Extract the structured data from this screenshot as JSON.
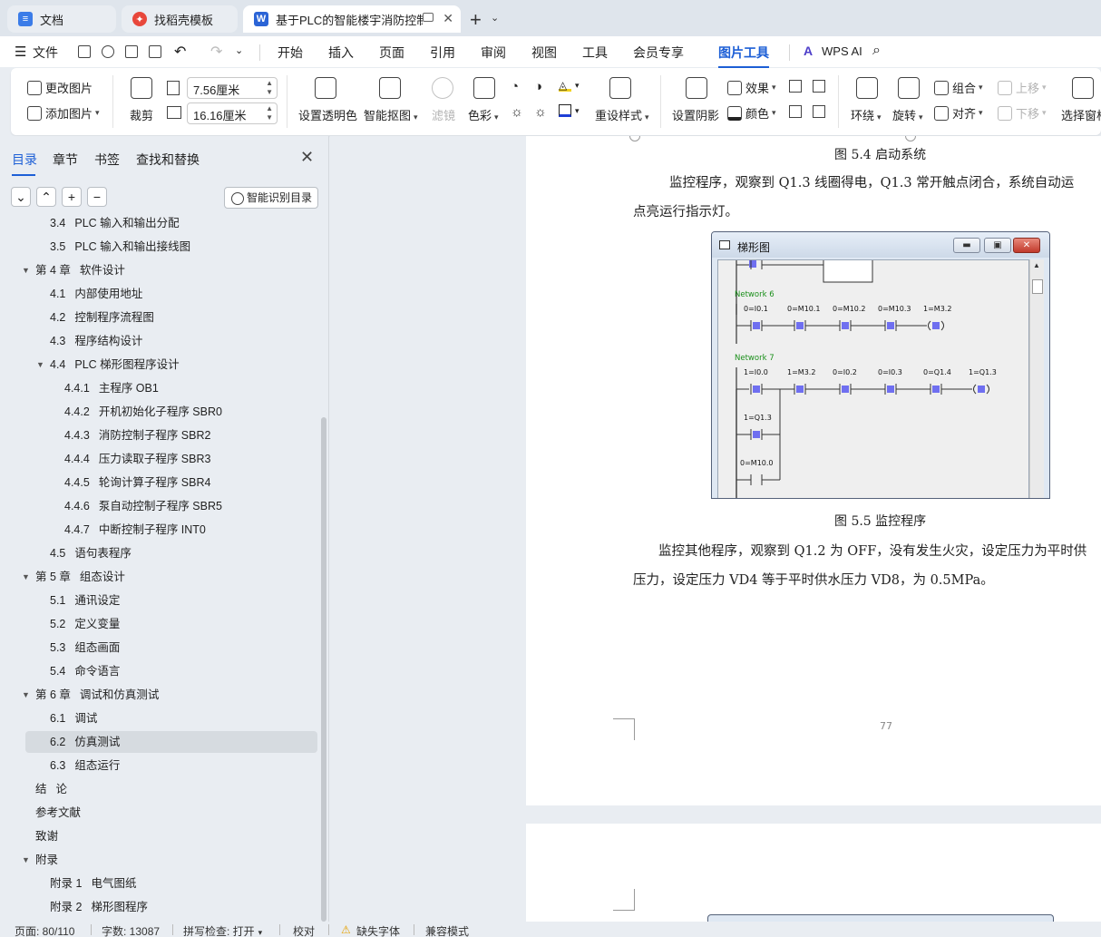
{
  "tabs": [
    {
      "label": "文档",
      "icon": "docs-icon"
    },
    {
      "label": "找稻壳模板",
      "icon": "docer-icon"
    },
    {
      "label": "基于PLC的智能楼宇消防控制系",
      "icon": "word-doc-icon"
    }
  ],
  "menu": {
    "file": "文件",
    "items": [
      "开始",
      "插入",
      "页面",
      "引用",
      "审阅",
      "视图",
      "工具",
      "会员专享",
      "图片工具"
    ],
    "active": "图片工具",
    "wps_ai": "WPS AI"
  },
  "ribbon": {
    "change_image": "更改图片",
    "add_image": "添加图片",
    "crop": "裁剪",
    "width_value": "7.56厘米",
    "height_value": "16.16厘米",
    "set_transparent": "设置透明色",
    "smart_cutout": "智能抠图",
    "filter": "滤镜",
    "color": "色彩",
    "reset_style": "重设样式",
    "set_shadow": "设置阴影",
    "effect": "效果",
    "color2": "颜色",
    "wrap": "环绕",
    "rotate": "旋转",
    "group": "组合",
    "align": "对齐",
    "move_up": "上移",
    "move_down": "下移",
    "select_pane": "选择窗格"
  },
  "panel": {
    "tabs": [
      "目录",
      "章节",
      "书签",
      "查找和替换"
    ],
    "active_tab": "目录",
    "ai_toc_button": "智能识别目录",
    "toc": [
      {
        "num": "3.4",
        "text": "PLC 输入和输出分配",
        "level": 2
      },
      {
        "num": "3.5",
        "text": "PLC 输入和输出接线图",
        "level": 2
      },
      {
        "num": "第 4 章",
        "text": "软件设计",
        "level": 1,
        "expanded": true
      },
      {
        "num": "4.1",
        "text": "内部使用地址",
        "level": 2
      },
      {
        "num": "4.2",
        "text": "控制程序流程图",
        "level": 2
      },
      {
        "num": "4.3",
        "text": "程序结构设计",
        "level": 2
      },
      {
        "num": "4.4",
        "text": "PLC 梯形图程序设计",
        "level": 2,
        "expanded": true
      },
      {
        "num": "4.4.1",
        "text": "主程序 OB1",
        "level": 3
      },
      {
        "num": "4.4.2",
        "text": "开机初始化子程序 SBR0",
        "level": 3
      },
      {
        "num": "4.4.3",
        "text": "消防控制子程序 SBR2",
        "level": 3
      },
      {
        "num": "4.4.4",
        "text": "压力读取子程序 SBR3",
        "level": 3
      },
      {
        "num": "4.4.5",
        "text": "轮询计算子程序 SBR4",
        "level": 3
      },
      {
        "num": "4.4.6",
        "text": "泵自动控制子程序 SBR5",
        "level": 3
      },
      {
        "num": "4.4.7",
        "text": "中断控制子程序 INT0",
        "level": 3
      },
      {
        "num": "4.5",
        "text": "语句表程序",
        "level": 2
      },
      {
        "num": "第 5 章",
        "text": "组态设计",
        "level": 1,
        "expanded": true
      },
      {
        "num": "5.1",
        "text": "通讯设定",
        "level": 2
      },
      {
        "num": "5.2",
        "text": "定义变量",
        "level": 2
      },
      {
        "num": "5.3",
        "text": "组态画面",
        "level": 2
      },
      {
        "num": "5.4",
        "text": "命令语言",
        "level": 2
      },
      {
        "num": "第 6 章",
        "text": "调试和仿真测试",
        "level": 1,
        "expanded": true
      },
      {
        "num": "6.1",
        "text": "调试",
        "level": 2
      },
      {
        "num": "6.2",
        "text": "仿真测试",
        "level": 2,
        "selected": true
      },
      {
        "num": "6.3",
        "text": "组态运行",
        "level": 2
      },
      {
        "num": "结",
        "text": "论",
        "level": 1
      },
      {
        "num": "",
        "text": "参考文献",
        "level": 1
      },
      {
        "num": "",
        "text": "致谢",
        "level": 1
      },
      {
        "num": "",
        "text": "附录",
        "level": 1,
        "expanded": true
      },
      {
        "num": "附录 1",
        "text": "电气图纸",
        "level": 2
      },
      {
        "num": "附录 2",
        "text": "梯形图程序",
        "level": 2
      }
    ]
  },
  "document": {
    "caption_top": "图 5.4 启动系统",
    "para1_line1": "监控程序，观察到 Q1.3 线圈得电，Q1.3 常开触点闭合，系统自动运",
    "para1_line2": "点亮运行指示灯。",
    "caption_mid": "图 5.5 监控程序",
    "para2_line1": "监控其他程序，观察到 Q1.2 为 OFF，没有发生火灾，设定压力为平时供",
    "para2_line2": "压力，设定压力 VD4 等于平时供水压力 VD8，为 0.5MPa。",
    "page_number": "77"
  },
  "ladder": {
    "window_title": "梯形图",
    "network6": {
      "label": "Network 6",
      "contacts": [
        "0=I0.1",
        "0=M10.1",
        "0=M10.2",
        "0=M10.3"
      ],
      "coil": "1=M3.2"
    },
    "network7": {
      "label": "Network 7",
      "contacts": [
        "1=I0.0",
        "1=M3.2",
        "0=I0.2",
        "0=I0.3",
        "0=Q1.4"
      ],
      "coil": "1=Q1.3",
      "branch": [
        "1=Q1.3",
        "0=M10.0"
      ]
    }
  },
  "status": {
    "page": "页面: 80/110",
    "words": "字数: 13087",
    "spell": "拼写检查: 打开",
    "proof": "校对",
    "missing_font": "缺失字体",
    "compat": "兼容模式"
  }
}
